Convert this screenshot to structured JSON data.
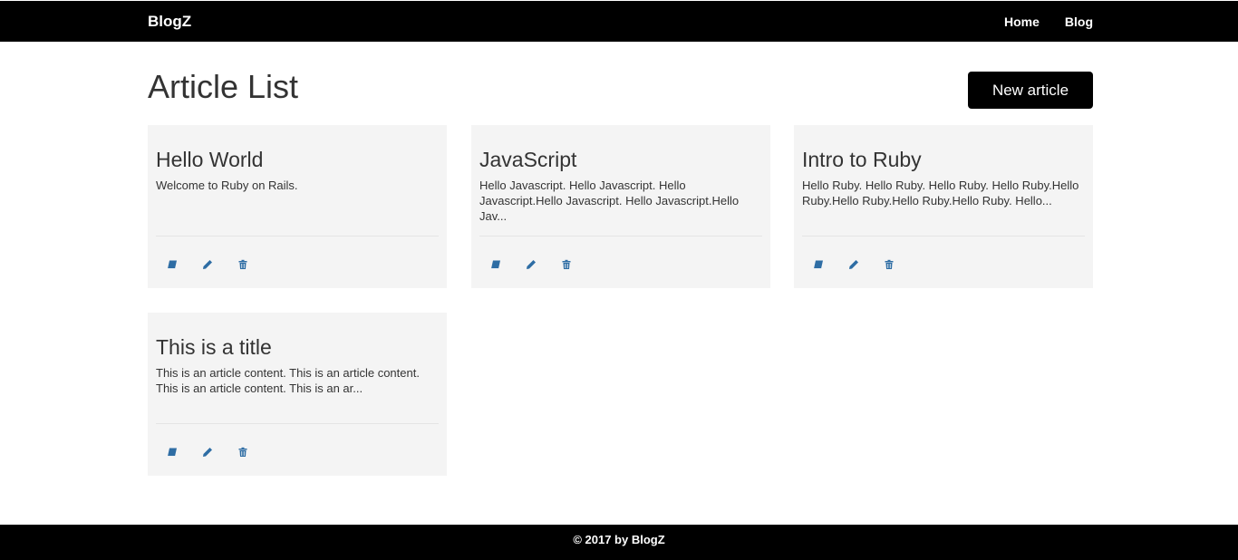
{
  "navbar": {
    "brand": "BlogZ",
    "links": [
      {
        "label": "Home"
      },
      {
        "label": "Blog"
      }
    ]
  },
  "page": {
    "title": "Article List",
    "new_button_label": "New article"
  },
  "articles": [
    {
      "title": "Hello World",
      "excerpt": "Welcome to Ruby on Rails.",
      "actions": [
        "book-icon",
        "pencil-icon",
        "trash-icon"
      ]
    },
    {
      "title": "JavaScript",
      "excerpt": "Hello Javascript. Hello Javascript. Hello Javascript.Hello Javascript. Hello Javascript.Hello Jav...",
      "actions": [
        "book-icon",
        "pencil-icon",
        "trash-icon"
      ]
    },
    {
      "title": "Intro to Ruby",
      "excerpt": "Hello Ruby. Hello Ruby. Hello Ruby. Hello Ruby.Hello Ruby.Hello Ruby.Hello Ruby.Hello Ruby. Hello...",
      "actions": [
        "book-icon",
        "pencil-icon",
        "trash-icon"
      ]
    },
    {
      "title": "This is a title",
      "excerpt": "This is an article content. This is an article content. This is an article content. This is an ar...",
      "actions": [
        "book-icon",
        "pencil-icon",
        "trash-icon"
      ]
    }
  ],
  "footer": {
    "text": "© 2017 by BlogZ"
  },
  "colors": {
    "navbar_bg": "#000000",
    "card_bg": "#f4f4f4",
    "icon": "#2e6da4",
    "button_bg": "#000000"
  }
}
